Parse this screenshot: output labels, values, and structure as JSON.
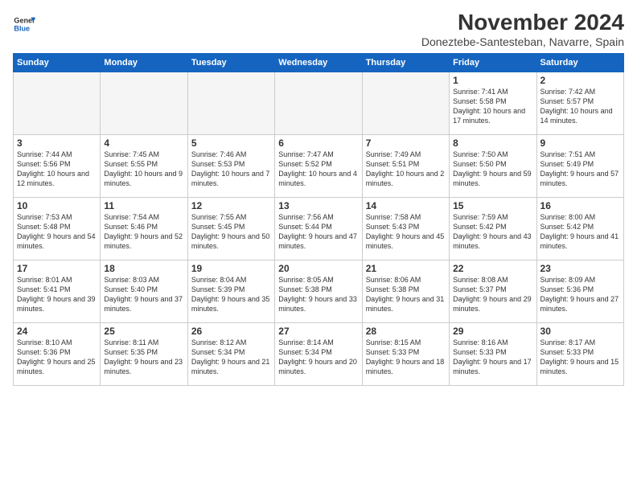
{
  "header": {
    "logo_line1": "General",
    "logo_line2": "Blue",
    "month_title": "November 2024",
    "location": "Doneztebe-Santesteban, Navarre, Spain"
  },
  "days_of_week": [
    "Sunday",
    "Monday",
    "Tuesday",
    "Wednesday",
    "Thursday",
    "Friday",
    "Saturday"
  ],
  "weeks": [
    [
      {
        "day": "",
        "empty": true
      },
      {
        "day": "",
        "empty": true
      },
      {
        "day": "",
        "empty": true
      },
      {
        "day": "",
        "empty": true
      },
      {
        "day": "",
        "empty": true
      },
      {
        "day": "1",
        "sunrise": "Sunrise: 7:41 AM",
        "sunset": "Sunset: 5:58 PM",
        "daylight": "Daylight: 10 hours and 17 minutes."
      },
      {
        "day": "2",
        "sunrise": "Sunrise: 7:42 AM",
        "sunset": "Sunset: 5:57 PM",
        "daylight": "Daylight: 10 hours and 14 minutes."
      }
    ],
    [
      {
        "day": "3",
        "sunrise": "Sunrise: 7:44 AM",
        "sunset": "Sunset: 5:56 PM",
        "daylight": "Daylight: 10 hours and 12 minutes."
      },
      {
        "day": "4",
        "sunrise": "Sunrise: 7:45 AM",
        "sunset": "Sunset: 5:55 PM",
        "daylight": "Daylight: 10 hours and 9 minutes."
      },
      {
        "day": "5",
        "sunrise": "Sunrise: 7:46 AM",
        "sunset": "Sunset: 5:53 PM",
        "daylight": "Daylight: 10 hours and 7 minutes."
      },
      {
        "day": "6",
        "sunrise": "Sunrise: 7:47 AM",
        "sunset": "Sunset: 5:52 PM",
        "daylight": "Daylight: 10 hours and 4 minutes."
      },
      {
        "day": "7",
        "sunrise": "Sunrise: 7:49 AM",
        "sunset": "Sunset: 5:51 PM",
        "daylight": "Daylight: 10 hours and 2 minutes."
      },
      {
        "day": "8",
        "sunrise": "Sunrise: 7:50 AM",
        "sunset": "Sunset: 5:50 PM",
        "daylight": "Daylight: 9 hours and 59 minutes."
      },
      {
        "day": "9",
        "sunrise": "Sunrise: 7:51 AM",
        "sunset": "Sunset: 5:49 PM",
        "daylight": "Daylight: 9 hours and 57 minutes."
      }
    ],
    [
      {
        "day": "10",
        "sunrise": "Sunrise: 7:53 AM",
        "sunset": "Sunset: 5:48 PM",
        "daylight": "Daylight: 9 hours and 54 minutes."
      },
      {
        "day": "11",
        "sunrise": "Sunrise: 7:54 AM",
        "sunset": "Sunset: 5:46 PM",
        "daylight": "Daylight: 9 hours and 52 minutes."
      },
      {
        "day": "12",
        "sunrise": "Sunrise: 7:55 AM",
        "sunset": "Sunset: 5:45 PM",
        "daylight": "Daylight: 9 hours and 50 minutes."
      },
      {
        "day": "13",
        "sunrise": "Sunrise: 7:56 AM",
        "sunset": "Sunset: 5:44 PM",
        "daylight": "Daylight: 9 hours and 47 minutes."
      },
      {
        "day": "14",
        "sunrise": "Sunrise: 7:58 AM",
        "sunset": "Sunset: 5:43 PM",
        "daylight": "Daylight: 9 hours and 45 minutes."
      },
      {
        "day": "15",
        "sunrise": "Sunrise: 7:59 AM",
        "sunset": "Sunset: 5:42 PM",
        "daylight": "Daylight: 9 hours and 43 minutes."
      },
      {
        "day": "16",
        "sunrise": "Sunrise: 8:00 AM",
        "sunset": "Sunset: 5:42 PM",
        "daylight": "Daylight: 9 hours and 41 minutes."
      }
    ],
    [
      {
        "day": "17",
        "sunrise": "Sunrise: 8:01 AM",
        "sunset": "Sunset: 5:41 PM",
        "daylight": "Daylight: 9 hours and 39 minutes."
      },
      {
        "day": "18",
        "sunrise": "Sunrise: 8:03 AM",
        "sunset": "Sunset: 5:40 PM",
        "daylight": "Daylight: 9 hours and 37 minutes."
      },
      {
        "day": "19",
        "sunrise": "Sunrise: 8:04 AM",
        "sunset": "Sunset: 5:39 PM",
        "daylight": "Daylight: 9 hours and 35 minutes."
      },
      {
        "day": "20",
        "sunrise": "Sunrise: 8:05 AM",
        "sunset": "Sunset: 5:38 PM",
        "daylight": "Daylight: 9 hours and 33 minutes."
      },
      {
        "day": "21",
        "sunrise": "Sunrise: 8:06 AM",
        "sunset": "Sunset: 5:38 PM",
        "daylight": "Daylight: 9 hours and 31 minutes."
      },
      {
        "day": "22",
        "sunrise": "Sunrise: 8:08 AM",
        "sunset": "Sunset: 5:37 PM",
        "daylight": "Daylight: 9 hours and 29 minutes."
      },
      {
        "day": "23",
        "sunrise": "Sunrise: 8:09 AM",
        "sunset": "Sunset: 5:36 PM",
        "daylight": "Daylight: 9 hours and 27 minutes."
      }
    ],
    [
      {
        "day": "24",
        "sunrise": "Sunrise: 8:10 AM",
        "sunset": "Sunset: 5:36 PM",
        "daylight": "Daylight: 9 hours and 25 minutes."
      },
      {
        "day": "25",
        "sunrise": "Sunrise: 8:11 AM",
        "sunset": "Sunset: 5:35 PM",
        "daylight": "Daylight: 9 hours and 23 minutes."
      },
      {
        "day": "26",
        "sunrise": "Sunrise: 8:12 AM",
        "sunset": "Sunset: 5:34 PM",
        "daylight": "Daylight: 9 hours and 21 minutes."
      },
      {
        "day": "27",
        "sunrise": "Sunrise: 8:14 AM",
        "sunset": "Sunset: 5:34 PM",
        "daylight": "Daylight: 9 hours and 20 minutes."
      },
      {
        "day": "28",
        "sunrise": "Sunrise: 8:15 AM",
        "sunset": "Sunset: 5:33 PM",
        "daylight": "Daylight: 9 hours and 18 minutes."
      },
      {
        "day": "29",
        "sunrise": "Sunrise: 8:16 AM",
        "sunset": "Sunset: 5:33 PM",
        "daylight": "Daylight: 9 hours and 17 minutes."
      },
      {
        "day": "30",
        "sunrise": "Sunrise: 8:17 AM",
        "sunset": "Sunset: 5:33 PM",
        "daylight": "Daylight: 9 hours and 15 minutes."
      }
    ]
  ]
}
